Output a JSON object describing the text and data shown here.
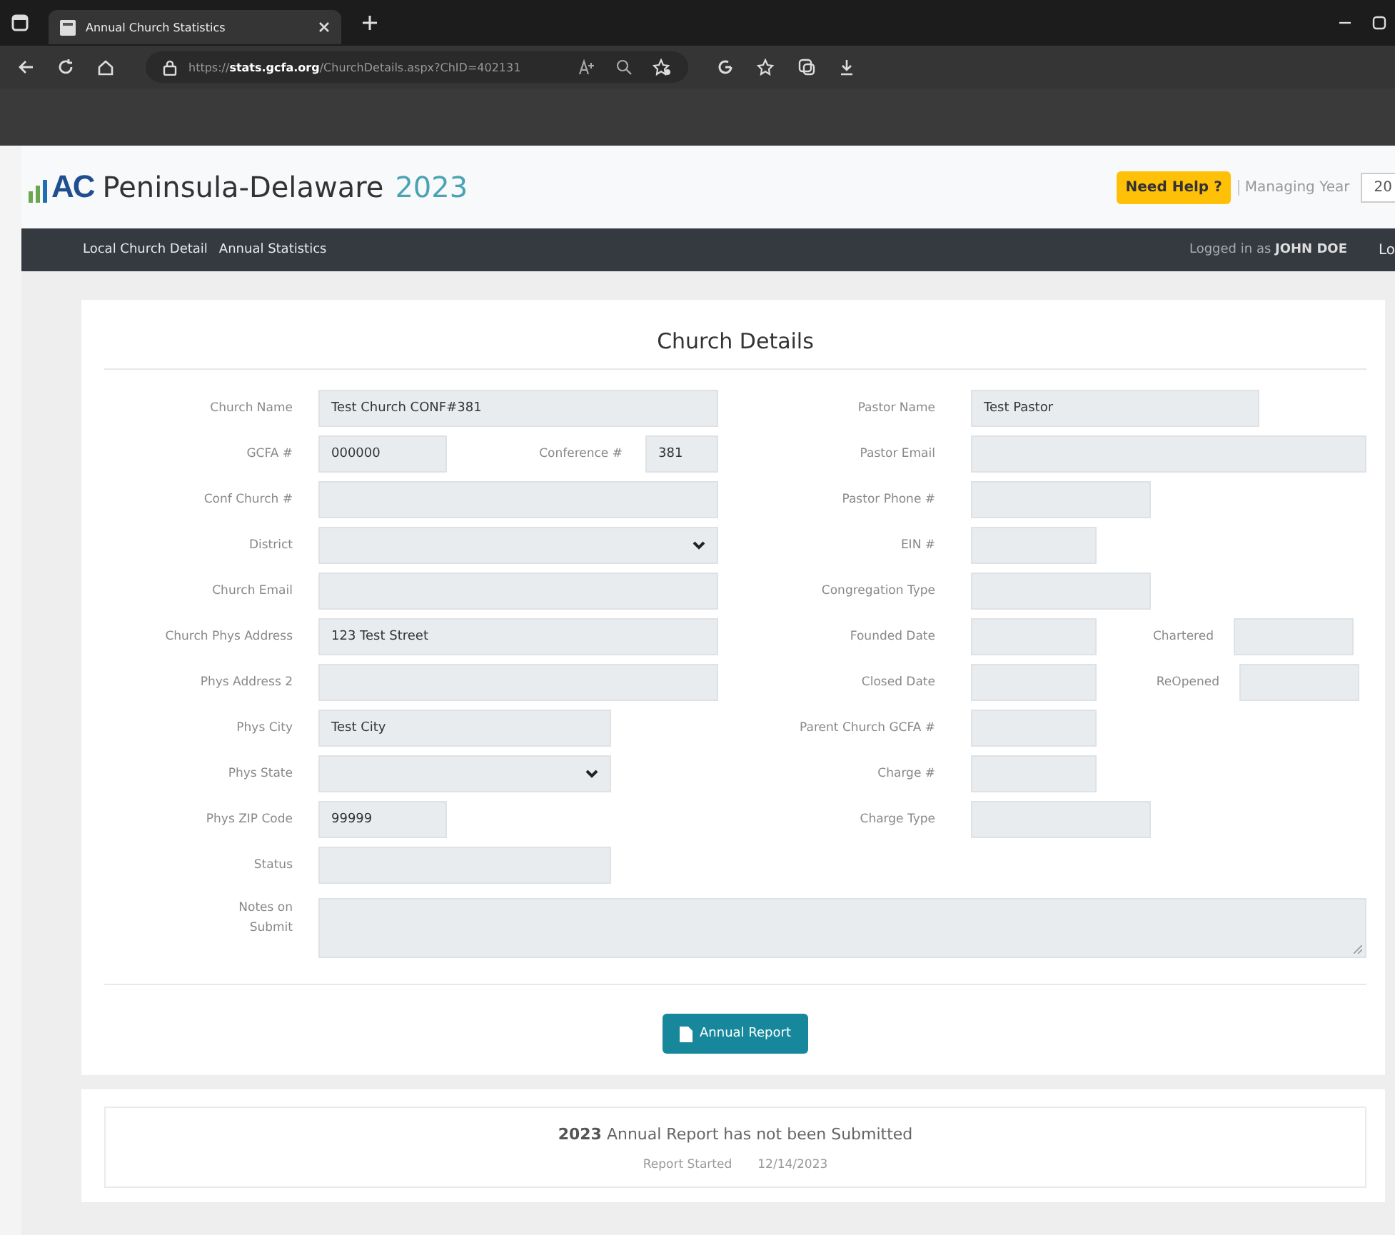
{
  "browser": {
    "tab_title": "Annual Church Statistics",
    "url": "https://**stats.gcfa.org**/ChurchDetails.aspx?ChID=402131"
  },
  "header": {
    "brand_mark": "AC",
    "site_name": "Peninsula-Delaware",
    "year": "2023",
    "help_button": "Need Help ?",
    "managing_year_label": "Managing Year",
    "managing_year_value": "20"
  },
  "nav": {
    "links": [
      "Local Church Detail",
      "Annual Statistics"
    ],
    "login_text": "Logged in as **JOHN DOE**",
    "cut_link": "Lo"
  },
  "church_details": {
    "title": "Church Details",
    "left_rows": [
      {
        "label": "Church Name",
        "fields": [
          {
            "kind": "input",
            "value": "Test Church CONF#381"
          }
        ]
      },
      {
        "label": "GCFA #",
        "fields": [
          {
            "kind": "input",
            "value": "000000"
          },
          {
            "kind": "input",
            "label": "Conference #",
            "value": "381"
          }
        ]
      },
      {
        "label": "Conf Church #",
        "fields": [
          {
            "kind": "input"
          }
        ]
      },
      {
        "label": "District",
        "fields": [
          {
            "kind": "select"
          }
        ]
      },
      {
        "label": "Church Email",
        "fields": [
          {
            "kind": "input"
          }
        ]
      },
      {
        "label": "Church Phys Address",
        "fields": [
          {
            "kind": "input",
            "value": "123 Test Street"
          }
        ]
      },
      {
        "label": "Phys Address 2",
        "fields": [
          {
            "kind": "input"
          }
        ]
      },
      {
        "label": "Phys City",
        "fields": [
          {
            "kind": "input",
            "value": "Test City"
          }
        ]
      },
      {
        "label": "Phys State",
        "fields": [
          {
            "kind": "select"
          }
        ]
      },
      {
        "label": "Phys ZIP Code",
        "fields": [
          {
            "kind": "input",
            "value": "99999"
          }
        ]
      },
      {
        "label": "Status",
        "fields": [
          {
            "kind": "input"
          }
        ]
      }
    ],
    "right_rows": [
      {
        "label": "Pastor Name",
        "fields": [
          {
            "kind": "input",
            "value": "Test Pastor"
          }
        ]
      },
      {
        "label": "Pastor Email",
        "fields": [
          {
            "kind": "input"
          }
        ]
      },
      {
        "label": "Pastor Phone #",
        "fields": [
          {
            "kind": "input"
          }
        ]
      },
      {
        "label": "EIN #",
        "fields": [
          {
            "kind": "input"
          }
        ]
      },
      {
        "label": "Congregation Type",
        "fields": [
          {
            "kind": "input"
          }
        ]
      },
      {
        "label": "Founded Date",
        "fields": [
          {
            "kind": "input"
          },
          {
            "kind": "input",
            "label": "Chartered"
          }
        ]
      },
      {
        "label": "Closed Date",
        "fields": [
          {
            "kind": "input"
          },
          {
            "kind": "input",
            "label": "ReOpened"
          }
        ]
      },
      {
        "label": "Parent Church GCFA #",
        "fields": [
          {
            "kind": "input"
          }
        ]
      },
      {
        "label": "Charge #",
        "fields": [
          {
            "kind": "input"
          }
        ]
      },
      {
        "label": "Charge Type",
        "fields": [
          {
            "kind": "input"
          }
        ]
      }
    ],
    "notes": {
      "label": "Notes on Submit",
      "kind": "textarea"
    },
    "report_button": "Annual Report"
  },
  "status_card": {
    "message": "**2023** Annual Report has not been Submitted",
    "started_label": "Report Started",
    "started_date": "12/14/2023"
  }
}
